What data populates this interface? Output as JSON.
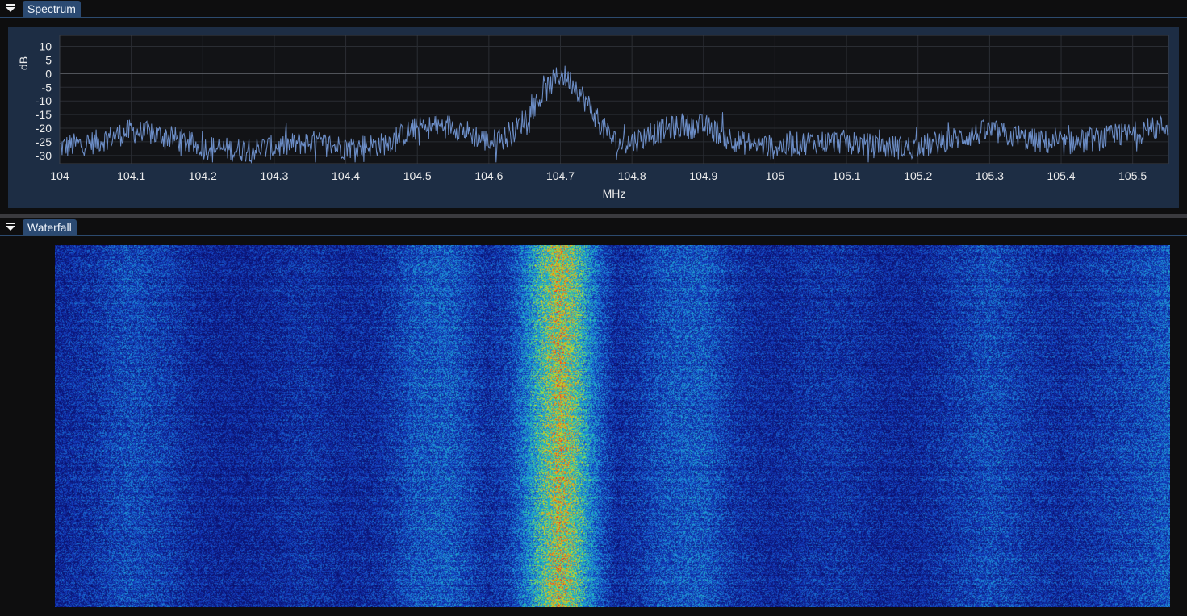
{
  "panels": {
    "spectrum": {
      "title": "Spectrum"
    },
    "waterfall": {
      "title": "Waterfall"
    }
  },
  "icons": {
    "collapse": "triangle-down-icon"
  },
  "colors": {
    "panel_tab": "#2b4a72",
    "plot_frame": "#1d2d44",
    "plot_background": "#121316",
    "trace": "#6d8fc9",
    "grid": "#2a2d33",
    "zero_line": "#5a5d63"
  },
  "chart_data": {
    "type": "line",
    "title": "",
    "xlabel": "MHz",
    "ylabel": "dB",
    "xlim": [
      104.0,
      105.55
    ],
    "ylim": [
      -33,
      14
    ],
    "x_ticks": [
      104,
      104.1,
      104.2,
      104.3,
      104.4,
      104.5,
      104.6,
      104.7,
      104.8,
      104.9,
      105,
      105.1,
      105.2,
      105.3,
      105.4,
      105.5
    ],
    "x_tick_labels": [
      "104",
      "104.1",
      "104.2",
      "104.3",
      "104.4",
      "104.5",
      "104.6",
      "104.7",
      "104.8",
      "104.9",
      "105",
      "105.1",
      "105.2",
      "105.3",
      "105.4",
      "105.5"
    ],
    "y_ticks": [
      10,
      5,
      0,
      -5,
      -10,
      -15,
      -20,
      -25,
      -30
    ],
    "y_tick_labels": [
      "10",
      "5",
      "0",
      "-5",
      "-10",
      "-15",
      "-20",
      "-25",
      "-30"
    ],
    "grid": true,
    "series": [
      {
        "x": [
          104.0,
          104.05,
          104.1,
          104.15,
          104.2,
          104.25,
          104.3,
          104.35,
          104.4,
          104.45,
          104.5,
          104.55,
          104.6,
          104.63,
          104.66,
          104.68,
          104.7,
          104.72,
          104.74,
          104.76,
          104.78,
          104.8,
          104.85,
          104.9,
          104.95,
          105.0,
          105.05,
          105.1,
          105.15,
          105.2,
          105.25,
          105.3,
          105.35,
          105.4,
          105.45,
          105.5,
          105.55
        ],
        "y": [
          -27,
          -25,
          -21,
          -23,
          -27,
          -28,
          -27,
          -25,
          -27,
          -26,
          -20,
          -19,
          -25,
          -23,
          -13,
          -6,
          0,
          -4,
          -12,
          -20,
          -26,
          -25,
          -20,
          -19,
          -25,
          -27,
          -25,
          -25,
          -27,
          -27,
          -24,
          -21,
          -24,
          -26,
          -24,
          -22,
          -19
        ]
      }
    ]
  }
}
